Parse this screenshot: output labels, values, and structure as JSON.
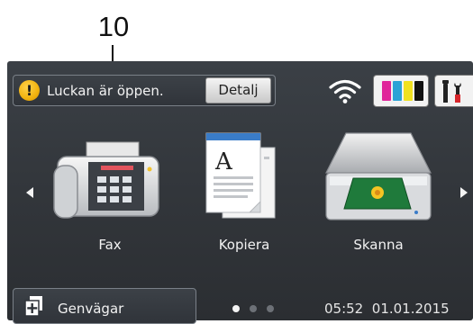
{
  "callout": {
    "number": "10"
  },
  "status": {
    "message": "Luckan är öppen.",
    "detail_label": "Detalj",
    "icon": "warning-icon"
  },
  "toolbar": {
    "wifi_icon": "wifi-icon",
    "ink_icon": "ink-cartridges-icon",
    "ink_colors": [
      "#e0259a",
      "#2ba3d6",
      "#f0e120",
      "#111111"
    ],
    "settings_icon": "tools-icon"
  },
  "apps": [
    {
      "label": "Fax",
      "icon": "fax-icon"
    },
    {
      "label": "Kopiera",
      "icon": "copy-icon"
    },
    {
      "label": "Skanna",
      "icon": "scanner-icon"
    }
  ],
  "shortcuts": {
    "label": "Genvägar",
    "icon": "add-shortcut-icon"
  },
  "pagination": {
    "pages": 3,
    "current": 1
  },
  "clock": {
    "time": "05:52",
    "date": "01.01.2015"
  },
  "colors": {
    "screen_background": "#33373c",
    "text": "#f2f2f2",
    "warning": "#f2b20e"
  }
}
